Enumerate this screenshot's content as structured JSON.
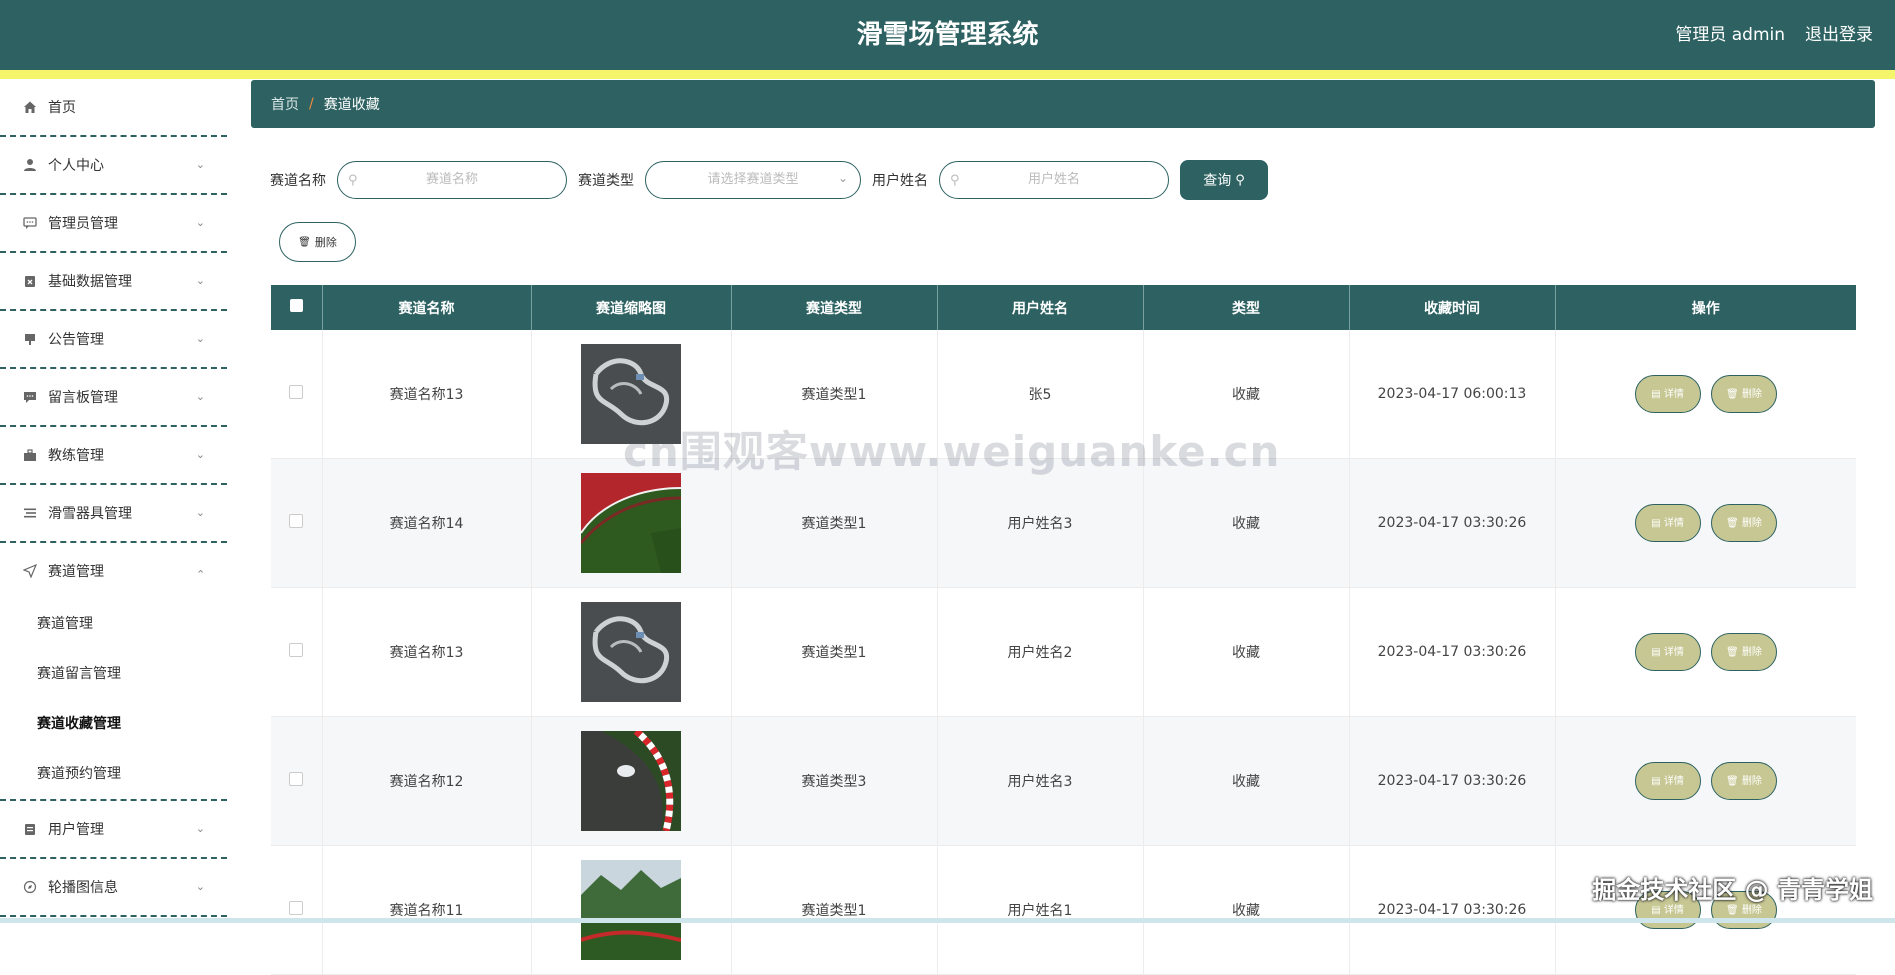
{
  "header": {
    "title": "滑雪场管理系统",
    "admin_label": "管理员 admin",
    "logout_label": "退出登录"
  },
  "sidebar": {
    "items": [
      {
        "label": "首页",
        "icon": "home-icon",
        "has_chevron": false
      },
      {
        "label": "个人中心",
        "icon": "user-icon",
        "has_chevron": true
      },
      {
        "label": "管理员管理",
        "icon": "chat-icon",
        "has_chevron": true
      },
      {
        "label": "基础数据管理",
        "icon": "clipboard-x-icon",
        "has_chevron": true
      },
      {
        "label": "公告管理",
        "icon": "speaker-icon",
        "has_chevron": true
      },
      {
        "label": "留言板管理",
        "icon": "message-icon",
        "has_chevron": true
      },
      {
        "label": "教练管理",
        "icon": "briefcase-icon",
        "has_chevron": true
      },
      {
        "label": "滑雪器具管理",
        "icon": "list-icon",
        "has_chevron": true
      },
      {
        "label": "赛道管理",
        "icon": "send-icon",
        "has_chevron": true,
        "expanded": true
      },
      {
        "label": "用户管理",
        "icon": "clipboard-icon",
        "has_chevron": true
      },
      {
        "label": "轮播图信息",
        "icon": "compass-icon",
        "has_chevron": true
      }
    ],
    "subitems": [
      {
        "label": "赛道管理",
        "active": false
      },
      {
        "label": "赛道留言管理",
        "active": false
      },
      {
        "label": "赛道收藏管理",
        "active": true
      },
      {
        "label": "赛道预约管理",
        "active": false
      }
    ]
  },
  "breadcrumb": {
    "home": "首页",
    "separator": "/",
    "current": "赛道收藏"
  },
  "search": {
    "track_name_label": "赛道名称",
    "track_name_placeholder": "赛道名称",
    "track_type_label": "赛道类型",
    "track_type_placeholder": "请选择赛道类型",
    "user_name_label": "用户姓名",
    "user_name_placeholder": "用户姓名",
    "query_label": "查询"
  },
  "toolbar": {
    "delete_label": "删除"
  },
  "table": {
    "columns": [
      "赛道名称",
      "赛道缩略图",
      "赛道类型",
      "用户姓名",
      "类型",
      "收藏时间",
      "操作"
    ],
    "rows": [
      {
        "name": "赛道名称13",
        "thumb": "track-aerial-gray",
        "type": "赛道类型1",
        "user": "张5",
        "kind": "收藏",
        "time": "2023-04-17 06:00:13"
      },
      {
        "name": "赛道名称14",
        "thumb": "track-red-stands",
        "type": "赛道类型1",
        "user": "用户姓名3",
        "kind": "收藏",
        "time": "2023-04-17 03:30:26"
      },
      {
        "name": "赛道名称13",
        "thumb": "track-aerial-gray",
        "type": "赛道类型1",
        "user": "用户姓名2",
        "kind": "收藏",
        "time": "2023-04-17 03:30:26"
      },
      {
        "name": "赛道名称12",
        "thumb": "track-curve-car",
        "type": "赛道类型3",
        "user": "用户姓名3",
        "kind": "收藏",
        "time": "2023-04-17 03:30:26"
      },
      {
        "name": "赛道名称11",
        "thumb": "track-mountain",
        "type": "赛道类型1",
        "user": "用户姓名1",
        "kind": "收藏",
        "time": "2023-04-17 03:30:26"
      }
    ],
    "detail_label": "详情",
    "delete_label": "删除"
  },
  "watermarks": {
    "center": "cn围观客www.weiguanke.cn",
    "corner": "掘金技术社区 @ 青青学姐"
  },
  "colors": {
    "primary": "#2e6262",
    "accent_strip": "#f4f56a",
    "action_button": "#c7c794",
    "breadcrumb_separator": "#f08a3c"
  }
}
